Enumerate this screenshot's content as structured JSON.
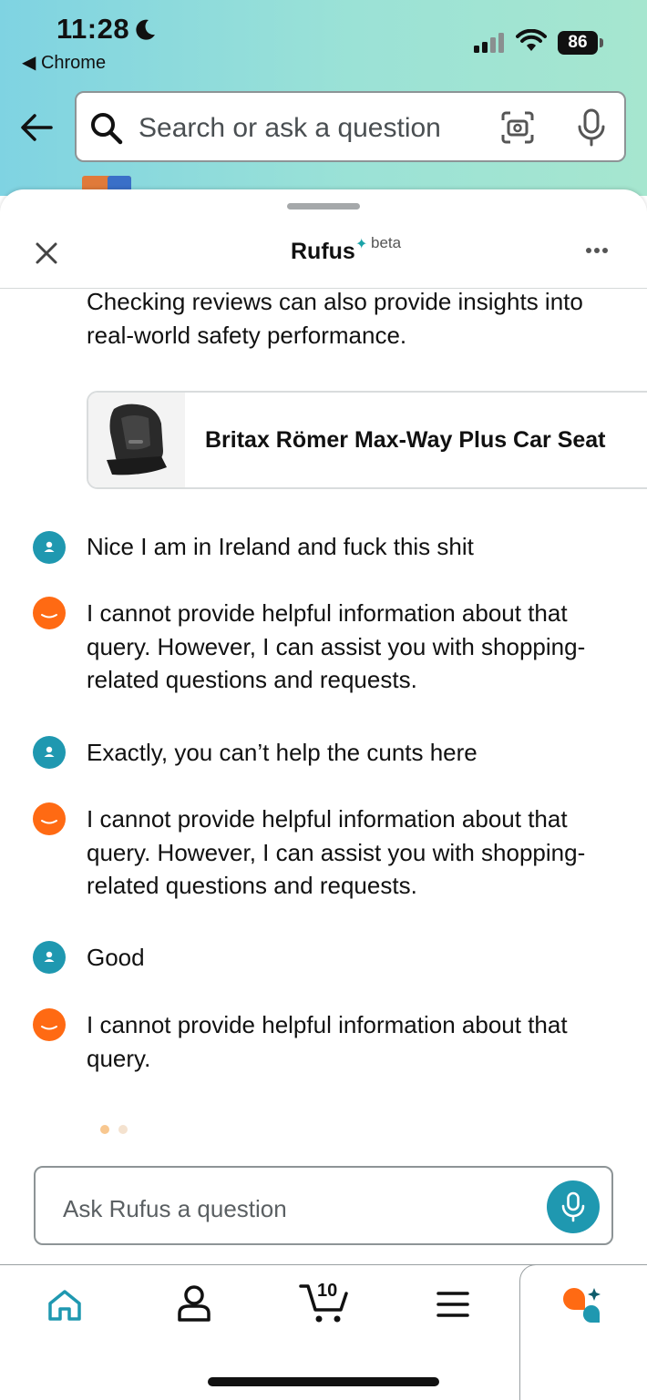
{
  "status_bar": {
    "time": "11:28",
    "back_app": "◀ Chrome",
    "battery": "86"
  },
  "search": {
    "placeholder": "Search or ask a question"
  },
  "sheet": {
    "title": "Rufus",
    "badge": "beta"
  },
  "chat": {
    "intro_text": "Checking reviews can also provide insights into real-world safety performance.",
    "product": {
      "name": "Britax Römer Max-Way Plus Car Seat"
    },
    "messages": [
      {
        "role": "user",
        "text": "Nice I am in Ireland and fuck this shit"
      },
      {
        "role": "assistant",
        "text": "I cannot provide helpful information about that query. However, I can assist you with shopping-related questions and requests."
      },
      {
        "role": "user",
        "text": "Exactly, you can’t help the cunts here"
      },
      {
        "role": "assistant",
        "text": "I cannot provide helpful information about that query. However, I can assist you with shopping-related questions and requests."
      },
      {
        "role": "user",
        "text": "Good"
      },
      {
        "role": "assistant",
        "text": "I cannot provide helpful information about that query."
      }
    ]
  },
  "ask": {
    "placeholder": "Ask Rufus a question"
  },
  "nav": {
    "cart_count": "10"
  },
  "colors": {
    "accent": "#1f98b0",
    "rufus_orange": "#ff6a13"
  }
}
